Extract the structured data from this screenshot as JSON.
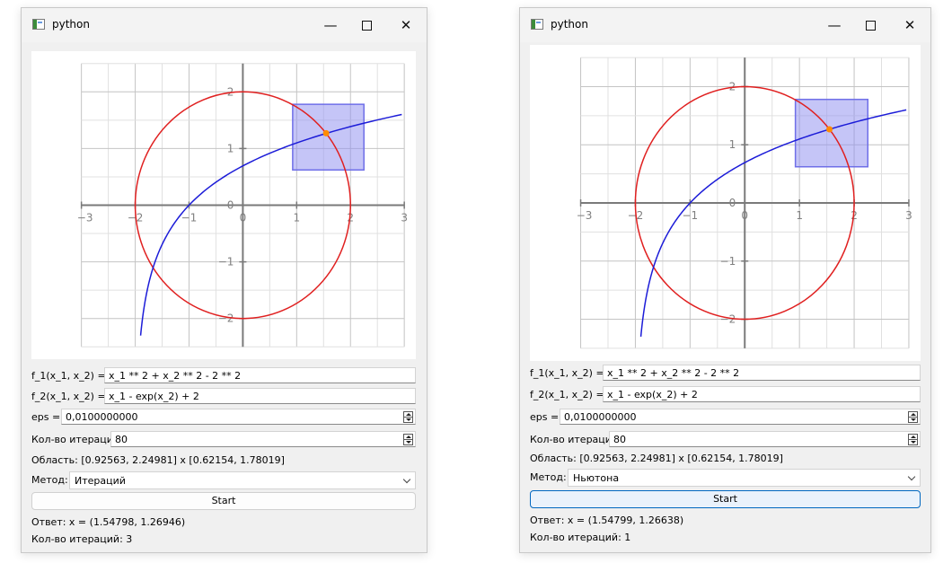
{
  "windows": [
    {
      "title": "python",
      "minimize_glyph": "—",
      "close_glyph": "✕",
      "f1_label": "f_1(x_1, x_2) =",
      "f1_value": "x_1 ** 2 + x_2 ** 2 - 2 ** 2",
      "f2_label": "f_2(x_1, x_2) =",
      "f2_value": "x_1 - exp(x_2) + 2",
      "eps_label": "eps =",
      "eps_value": "0,0100000000",
      "iter_label": "Кол-во итераций:",
      "iter_value": "80",
      "area_text": "Область: [0.92563, 2.24981] x [0.62154, 1.78019]",
      "method_label": "Метод:",
      "method_value": "Итераций",
      "start_label": "Start",
      "answer_text": "Ответ: x = (1.54798, 1.26946)",
      "iterations_text": "Кол-во итераций: 3"
    },
    {
      "title": "python",
      "minimize_glyph": "—",
      "close_glyph": "✕",
      "f1_label": "f_1(x_1, x_2) =",
      "f1_value": "x_1 ** 2 + x_2 ** 2 - 2 ** 2",
      "f2_label": "f_2(x_1, x_2) =",
      "f2_value": "x_1 - exp(x_2) + 2",
      "eps_label": "eps =",
      "eps_value": "0,0100000000",
      "iter_label": "Кол-во итераций:",
      "iter_value": "80",
      "area_text": "Область: [0.92563, 2.24981] x [0.62154, 1.78019]",
      "method_label": "Метод:",
      "method_value": "Ньютона",
      "start_label": "Start",
      "answer_text": "Ответ: x = (1.54799, 1.26638)",
      "iterations_text": "Кол-во итераций: 1"
    }
  ],
  "chart_data": [
    {
      "type": "line",
      "title": "",
      "xlabel": "",
      "ylabel": "",
      "xlim": [
        -3,
        3
      ],
      "ylim": [
        -2.5,
        2.5
      ],
      "grid": true,
      "x_ticks": [
        "−3",
        "−2",
        "−1",
        "0",
        "1",
        "2",
        "3"
      ],
      "y_ticks": [
        "−2",
        "−1",
        "0",
        "1",
        "2"
      ],
      "series": [
        {
          "kind": "circle",
          "equation": "x_1^2 + x_2^2 = 4",
          "color": "#e02020"
        },
        {
          "kind": "curve",
          "equation": "x_1 = exp(x_2) - 2",
          "color": "#1c1cd8"
        }
      ],
      "region": {
        "x": [
          0.92563,
          2.24981
        ],
        "y": [
          0.62154,
          1.78019
        ],
        "color": "#8c8cf0"
      },
      "solution_point": {
        "x": 1.54798,
        "y": 1.26946,
        "color": "#ff8c00"
      }
    },
    {
      "type": "line",
      "title": "",
      "xlabel": "",
      "ylabel": "",
      "xlim": [
        -3,
        3
      ],
      "ylim": [
        -2.5,
        2.5
      ],
      "grid": true,
      "x_ticks": [
        "−3",
        "−2",
        "−1",
        "0",
        "1",
        "2",
        "3"
      ],
      "y_ticks": [
        "−2",
        "−1",
        "0",
        "1",
        "2"
      ],
      "series": [
        {
          "kind": "circle",
          "equation": "x_1^2 + x_2^2 = 4",
          "color": "#e02020"
        },
        {
          "kind": "curve",
          "equation": "x_1 = exp(x_2) - 2",
          "color": "#1c1cd8"
        }
      ],
      "region": {
        "x": [
          0.92563,
          2.24981
        ],
        "y": [
          0.62154,
          1.78019
        ],
        "color": "#8c8cf0"
      },
      "solution_point": {
        "x": 1.54799,
        "y": 1.26638,
        "color": "#ff8c00"
      }
    }
  ]
}
